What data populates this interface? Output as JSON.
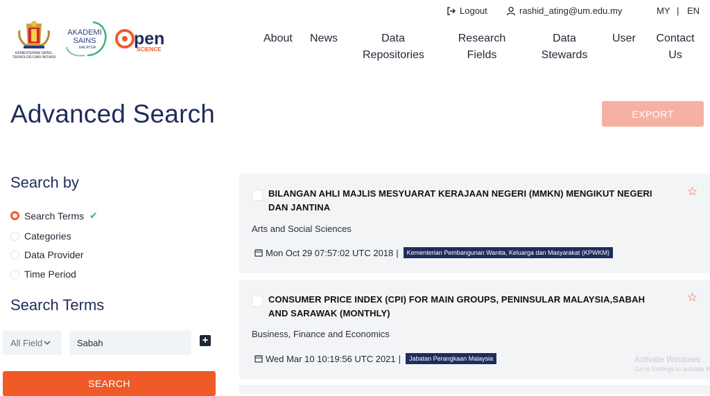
{
  "topbar": {
    "logout_label": "Logout",
    "user_email": "rashid_ating@um.edu.my",
    "lang_my": "MY",
    "lang_sep": "|",
    "lang_en": "EN"
  },
  "logos": {
    "ministry_text_1": "KEMENTERIAN SAINS,",
    "ministry_text_2": "TEKNOLOGI DAN INOVASI",
    "akademi_line1": "AKADEMI",
    "akademi_line2": "SAINS",
    "akademi_line3": "MALAYSIA",
    "open_word": "pen",
    "open_sub": "SCIENCE"
  },
  "nav": {
    "items": [
      {
        "line1": "About",
        "line2": ""
      },
      {
        "line1": "News",
        "line2": ""
      },
      {
        "line1": "Data",
        "line2": "Repositories"
      },
      {
        "line1": "Research",
        "line2": "Fields"
      },
      {
        "line1": "Data",
        "line2": "Stewards"
      },
      {
        "line1": "User",
        "line2": ""
      },
      {
        "line1": "Contact",
        "line2": "Us"
      }
    ]
  },
  "page": {
    "title": "Advanced Search",
    "export_label": "EXPORT"
  },
  "sidebar": {
    "search_by_heading": "Search by",
    "options": [
      {
        "label": "Search Terms",
        "selected": true,
        "checked": "✔"
      },
      {
        "label": "Categories",
        "selected": false
      },
      {
        "label": "Data Provider",
        "selected": false
      },
      {
        "label": "Time Period",
        "selected": false
      }
    ],
    "search_terms_heading": "Search Terms",
    "field_select_value": "All Field",
    "term_value": "Sabah",
    "add_label": "+",
    "search_label": "SEARCH"
  },
  "results": [
    {
      "title": "BILANGAN AHLI MAJLIS MESYUARAT KERAJAAN NEGERI (MMKN) MENGIKUT NEGERI DAN JANTINA",
      "category": "Arts and Social Sciences",
      "date": "Mon Oct 29 07:57:02 UTC 2018",
      "sep": "|",
      "org": "Kementerian Pembangunan Wanita, Keluarga dan Masyarakat (KPWKM)"
    },
    {
      "title": "CONSUMER PRICE INDEX (CPI) FOR MAIN GROUPS, PENINSULAR MALAYSIA,SABAH AND SARAWAK (MONTHLY)",
      "category": "Business, Finance and Economics",
      "date": "Wed Mar 10 10:19:56 UTC 2021",
      "sep": "|",
      "org": "Jabatan Perangkaan Malaysia"
    }
  ],
  "watermark": {
    "line1": "Activate Windows",
    "line2": "Go to Settings to activate Windows."
  },
  "colors": {
    "accent": "#f05a28",
    "navy": "#1f2c5c",
    "export_disabled": "#f6b1a3",
    "check_green": "#34b878"
  }
}
